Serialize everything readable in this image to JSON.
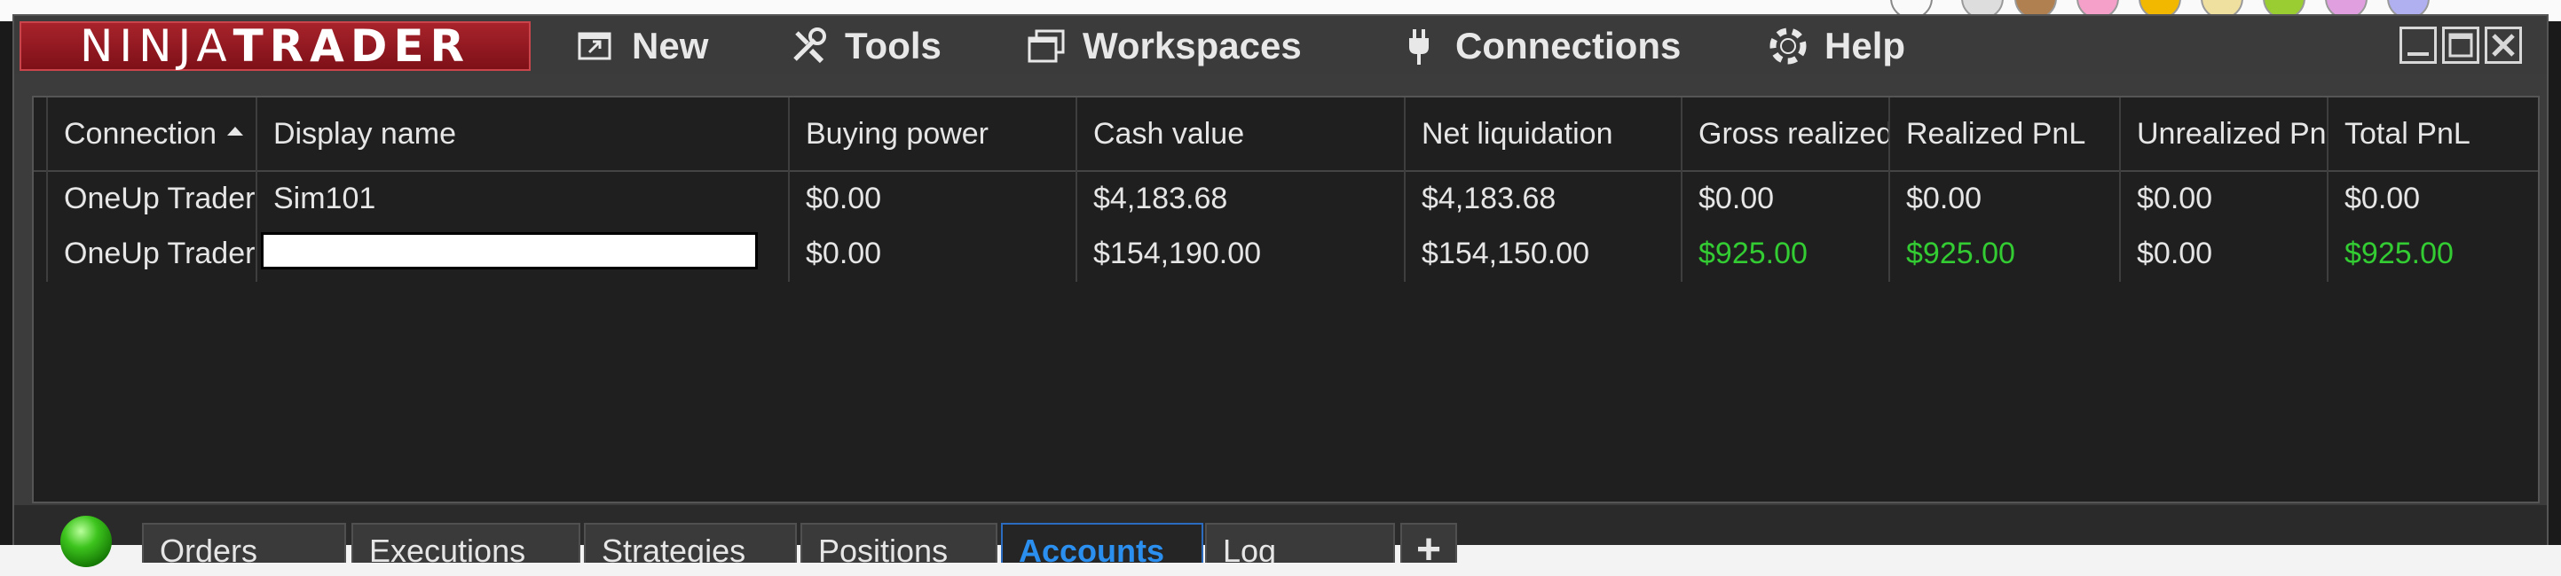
{
  "app": {
    "logo_light": "NINJA",
    "logo_bold": "TRADER",
    "brand_color": "#9b1c24"
  },
  "menu": {
    "items": [
      {
        "label": "New",
        "icon": "new-window-icon"
      },
      {
        "label": "Tools",
        "icon": "tools-icon"
      },
      {
        "label": "Workspaces",
        "icon": "workspaces-icon"
      },
      {
        "label": "Connections",
        "icon": "plug-icon"
      },
      {
        "label": "Help",
        "icon": "help-lifebuoy-icon"
      }
    ]
  },
  "window_controls": [
    "minimize-icon",
    "maximize-icon",
    "close-icon"
  ],
  "grid": {
    "headers": [
      "Connection",
      "Display name",
      "Buying power",
      "Cash value",
      "Net liquidation",
      "Gross realized",
      "Realized PnL",
      "Unrealized PnL",
      "Total PnL"
    ],
    "sorted_column": "Connection",
    "rows": [
      {
        "connection": "OneUp Trader",
        "display_name": "Sim101",
        "buying_power": "$0.00",
        "cash_value": "$4,183.68",
        "net_liquidation": "$4,183.68",
        "gross_realized": "$0.00",
        "realized_pnl": "$0.00",
        "unrealized_pnl": "$0.00",
        "total_pnl": "$0.00"
      },
      {
        "connection": "OneUp Trader",
        "display_name": "",
        "display_name_redacted": true,
        "buying_power": "$0.00",
        "cash_value": "$154,190.00",
        "net_liquidation": "$154,150.00",
        "gross_realized": "$925.00",
        "realized_pnl": "$925.00",
        "unrealized_pnl": "$0.00",
        "total_pnl": "$925.00"
      }
    ],
    "positive_color": "#33cc33"
  },
  "tabs": {
    "items": [
      "Orders",
      "Executions",
      "Strategies",
      "Positions",
      "Accounts",
      "Log"
    ],
    "active": "Accounts",
    "add_label": "+"
  },
  "status": {
    "connection_light": "green"
  }
}
